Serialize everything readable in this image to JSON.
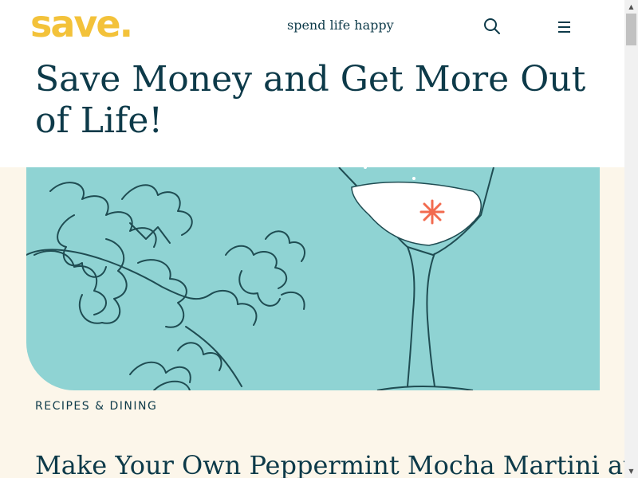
{
  "header": {
    "logo_text": "save.",
    "tagline": "spend life happy",
    "search_icon": "search-icon",
    "menu_icon": "hamburger-menu-icon"
  },
  "hero": {
    "title": "Save Money and Get More Out of Life!"
  },
  "article": {
    "image_description_icon": "martini-snowflake-illustration",
    "category": "RECIPES & DINING",
    "title": "Make Your Own Peppermint Mocha Martini at"
  },
  "colors": {
    "brand_yellow": "#f3c23a",
    "text_navy": "#0d3a49",
    "cream_background": "#fcf6ea",
    "illustration_teal": "#8fd3d3",
    "accent_coral": "#f26b4f"
  },
  "scrollbar": {
    "up_arrow": "▲",
    "down_arrow": "▼"
  }
}
